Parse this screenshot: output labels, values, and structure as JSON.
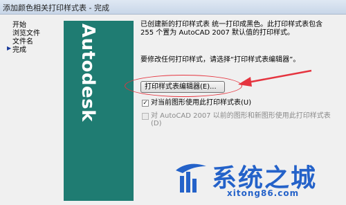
{
  "window": {
    "title": "添加颜色相关打印样式表 - 完成"
  },
  "steps": [
    {
      "label": "开始"
    },
    {
      "label": "浏览文件"
    },
    {
      "label": "文件名"
    },
    {
      "label": "完成",
      "current": true
    }
  ],
  "brand": {
    "logo_text": "Autodesk",
    "color": "#1f7c72"
  },
  "content": {
    "line1": "已创建新的打印样式表 统一打印成黑色。此打印样式表包含",
    "line2": "255 个置为 AutoCAD 2007 默认值的打印样式。",
    "instruction": "要修改任何打印样式，请选择“打印样式表编辑器”。",
    "editor_button": "打印样式表编辑器(E)...",
    "checkbox1": {
      "label": "对当前图形使用此打印样式表(U)",
      "checked": true
    },
    "checkbox2": {
      "label_line1": "对 AutoCAD 2007 以前的图形和新图形使用此打印样式表",
      "label_line2": "(D)",
      "checked": false,
      "enabled": false
    }
  },
  "annotation": {
    "color": "#e5343f"
  },
  "watermark": {
    "text": "系统之城",
    "url": "xitong86.com",
    "color": "#2462c9"
  }
}
